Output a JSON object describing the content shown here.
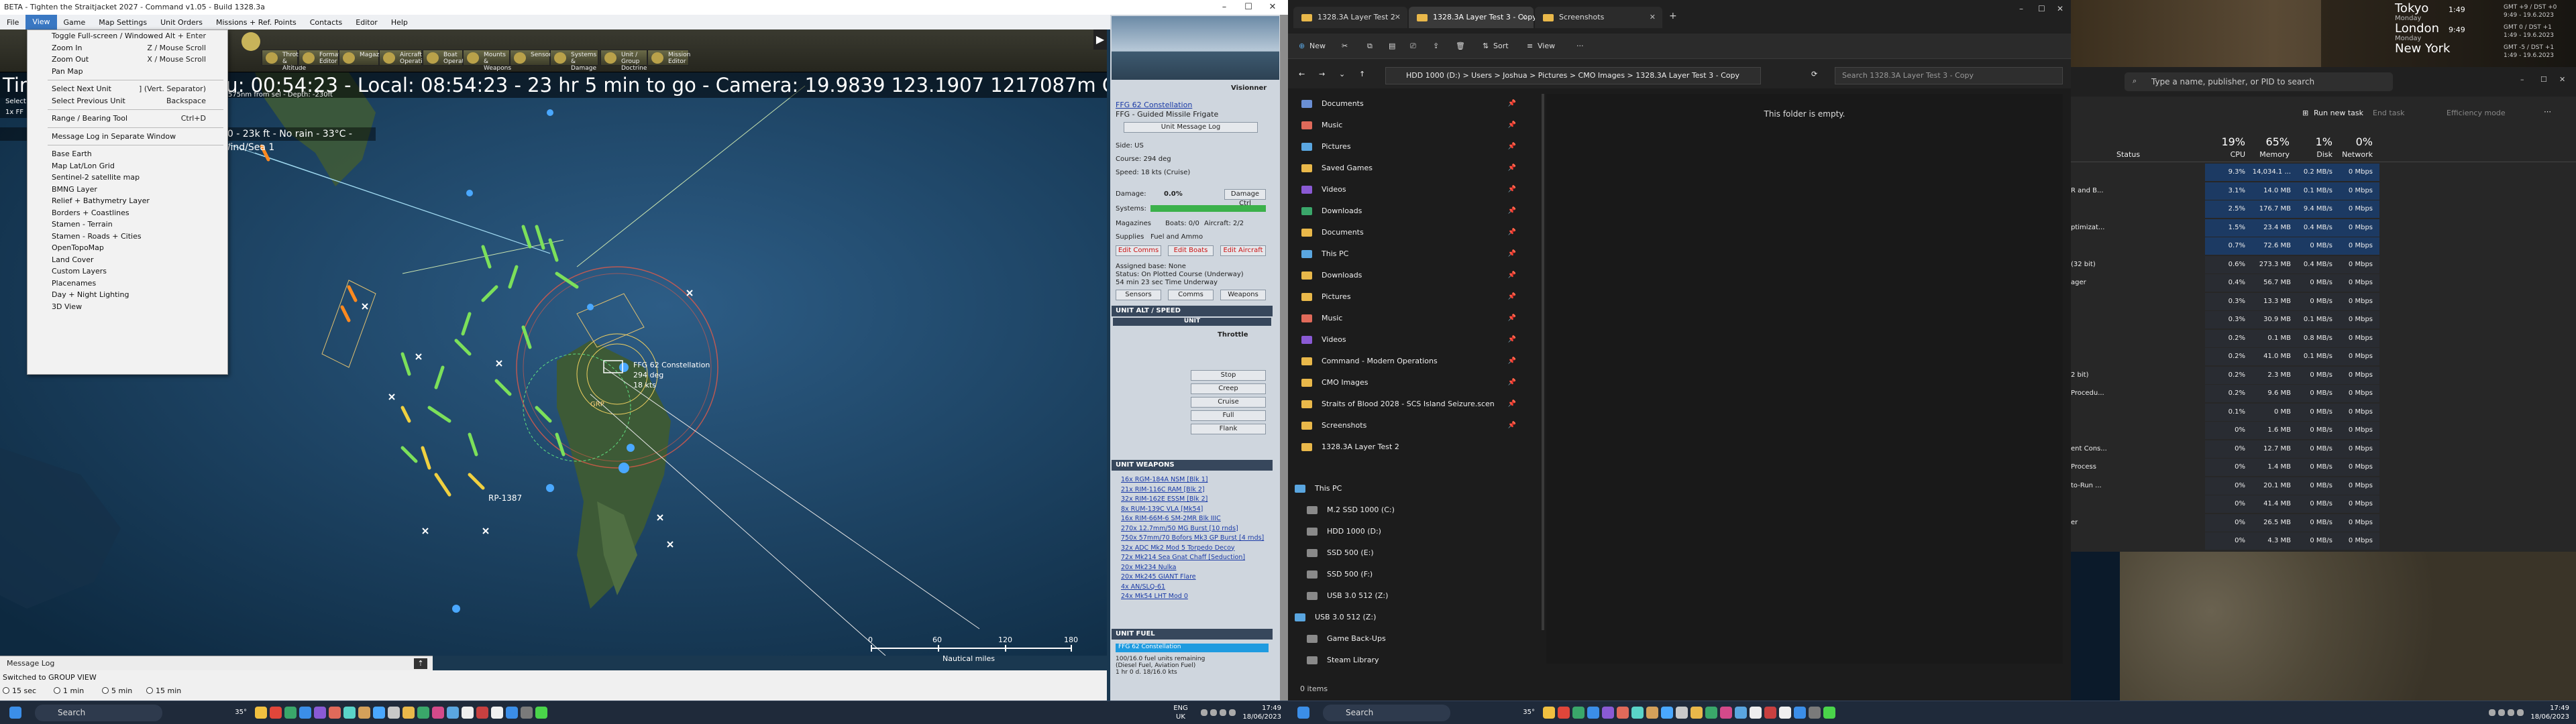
{
  "cmo": {
    "title": "BETA - Tighten the Straitjacket 2027 - Command v1.05 - Build 1328.3a",
    "menu": [
      "File",
      "View",
      "Game",
      "Map Settings",
      "Unit Orders",
      "Missions + Ref. Points",
      "Contacts",
      "Editor",
      "Help"
    ],
    "toolbar": [
      "Throttle & Altitude",
      "Formation Editor",
      "Magazines",
      "Aircraft Operations",
      "Boat Operations",
      "Mounts & Weapons",
      "Sensors",
      "Systems & Damage",
      "Unit / Group Doctrine",
      "Mission Editor"
    ],
    "status_bar": "Time: 2027/06/01 - Zulu: 00:54:23 - Local: 08:54:23 - 23 hr 5 min to go -  Camera: 19.9839 123.1907 1217087m  GPU: NVIDIA GeForce GTX 1080 Ti - AU Course: 294 deg",
    "weather": "20 - 23k ft - No rain - 33°C - Wind/Sea 1",
    "select_hint": "Select",
    "unit_hint": "1x FF",
    "depth_hint": "575nm from sel - Depth: -230ft",
    "view_menu": [
      {
        "label": "Toggle Full-screen / Windowed",
        "shortcut": "Alt + Enter"
      },
      {
        "label": "Zoom In",
        "shortcut": "Z / Mouse Scroll"
      },
      {
        "label": "Zoom Out",
        "shortcut": "X / Mouse Scroll"
      },
      {
        "label": "Pan Map",
        "shortcut": ""
      },
      {
        "label": "Select Next Unit",
        "shortcut": "] (Vert. Separator)"
      },
      {
        "label": "Select Previous Unit",
        "shortcut": "Backspace"
      },
      {
        "label": "Range / Bearing Tool",
        "shortcut": "Ctrl+D"
      },
      {
        "label": "Message Log in Separate Window",
        "shortcut": ""
      },
      {
        "label": "Base Earth",
        "shortcut": ""
      },
      {
        "label": "Map Lat/Lon Grid",
        "shortcut": ""
      },
      {
        "label": "Sentinel-2 satellite map",
        "shortcut": ""
      },
      {
        "label": "BMNG Layer",
        "shortcut": ""
      },
      {
        "label": "Relief + Bathymetry Layer",
        "shortcut": ""
      },
      {
        "label": "Borders + Coastlines",
        "shortcut": ""
      },
      {
        "label": "Stamen - Terrain",
        "shortcut": ""
      },
      {
        "label": "Stamen - Roads + Cities",
        "shortcut": ""
      },
      {
        "label": "OpenTopoMap",
        "shortcut": ""
      },
      {
        "label": "Land Cover",
        "shortcut": ""
      },
      {
        "label": "Custom Layers",
        "shortcut": ""
      },
      {
        "label": "Placenames",
        "shortcut": ""
      },
      {
        "label": "Day + Night Lighting",
        "shortcut": ""
      },
      {
        "label": "3D View",
        "shortcut": ""
      }
    ],
    "map_labels": {
      "unit": "FFG 62 Constellation",
      "course": "294 deg",
      "speed": "18 kts",
      "rp": "RP-1387",
      "grp": "GRP"
    },
    "scale": {
      "ticks": [
        "0",
        "60",
        "120",
        "180"
      ],
      "unit": "Nautical miles"
    },
    "message_log": "Message Log",
    "bottom": {
      "group_view": "Switched to GROUP VIEW",
      "speeds": [
        "15 sec",
        "1 min",
        "5 min",
        "15 min"
      ]
    },
    "side_panel": {
      "ship_name": "Visionner",
      "unit_name": "FFG 62 Constellation",
      "unit_class": "FFG - Guided Missile Frigate",
      "msg_log_btn": "Unit Message Log",
      "side": "Side: US",
      "course": "Course: 294 deg",
      "speed": "Speed: 18 kts (Cruise)",
      "damage_label": "Damage:",
      "damage_val": "0.0%",
      "damage_btn": "Damage Ctrl",
      "systems": "Systems:",
      "magazines": "Magazines",
      "boats": "Boats: 0/0",
      "aircraft": "Aircraft: 2/2",
      "supplies": "Supplies",
      "fuel": "Fuel and Ammo",
      "edit_btns": [
        "Edit Comms",
        "Edit Boats",
        "Edit Aircraft"
      ],
      "assigned": "Assigned base: None",
      "status": "Status: On Plotted Course (Underway)",
      "time": "54 min 23 sec Time Underway",
      "tabs": [
        "Sensors",
        "Comms",
        "Weapons"
      ],
      "alt_speed": "UNIT ALT / SPEED",
      "unit": "UNIT",
      "throttle": "Throttle",
      "throttle_btns": [
        "Stop",
        "Creep",
        "Cruise",
        "Full",
        "Flank"
      ],
      "weapons_head": "UNIT WEAPONS",
      "weapons": [
        "16x RGM-184A NSM [Blk 1]",
        "21x RIM-116C RAM [Blk 2]",
        "32x RIM-162E ESSM [Blk 2]",
        "8x RUM-139C VLA [Mk54]",
        "16x RIM-66M-6 SM-2MR Blk IIIC",
        "270x 12.7mm/50 MG Burst [10 rnds]",
        "750x 57mm/70 Bofors Mk3 GP Burst [4 rnds]",
        "32x ADC Mk2 Mod 5 Torpedo Decoy",
        "72x Mk214 Sea Gnat Chaff [Seduction]",
        "20x Mk234 Nulka",
        "20x Mk245 GIANT Flare",
        "4x AN/SLQ-61",
        "24x Mk54 LHT Mod 0"
      ],
      "fuel_head": "UNIT FUEL",
      "fuel_bar": "FFG 62 Constellation",
      "fuel_line1": "100/16.0 fuel units remaining",
      "fuel_line2": "(Diesel Fuel, Aviation Fuel)",
      "fuel_line3": "1 hr 0 d. 18/16.0 kts"
    }
  },
  "explorer": {
    "tabs": [
      "1328.3A Layer Test 2",
      "1328.3A Layer Test 3 - Copy",
      "Screenshots"
    ],
    "new_btn": "New",
    "sort_btn": "Sort",
    "view_btn": "View",
    "address": "HDD 1000 (D:)  >  Users  >  Joshua  >  Pictures  >  CMO Images  >  1328.3A Layer Test 3 - Copy",
    "search_placeholder": "Search 1328.3A Layer Test 3 - Copy",
    "empty_msg": "This folder is empty.",
    "nav": [
      {
        "label": "Documents",
        "color": "#6a8fd4",
        "pin": true
      },
      {
        "label": "Music",
        "color": "#e06a5a",
        "pin": true
      },
      {
        "label": "Pictures",
        "color": "#5aa6e0",
        "pin": true
      },
      {
        "label": "Saved Games",
        "color": "#e9b84a",
        "pin": true
      },
      {
        "label": "Videos",
        "color": "#8a5ad4",
        "pin": true
      },
      {
        "label": "Downloads",
        "color": "#3aa76a",
        "pin": true
      },
      {
        "label": "Documents",
        "color": "#e9b84a",
        "pin": true
      },
      {
        "label": "This PC",
        "color": "#5aa6e0",
        "pin": true
      },
      {
        "label": "Downloads",
        "color": "#e9b84a",
        "pin": true
      },
      {
        "label": "Pictures",
        "color": "#e9b84a",
        "pin": true
      },
      {
        "label": "Music",
        "color": "#e06a5a",
        "pin": true
      },
      {
        "label": "Videos",
        "color": "#8a5ad4",
        "pin": true
      },
      {
        "label": "Command - Modern Operations",
        "color": "#e9b84a",
        "pin": true
      },
      {
        "label": "CMO Images",
        "color": "#e9b84a",
        "pin": true
      },
      {
        "label": "Straits of Blood 2028 - SCS Island Seizure.scen",
        "color": "#e9b84a",
        "pin": true
      },
      {
        "label": "Screenshots",
        "color": "#e9b84a",
        "pin": true
      },
      {
        "label": "1328.3A Layer Test 2",
        "color": "#e9b84a",
        "pin": false
      }
    ],
    "tree": [
      {
        "label": "This PC",
        "indent": 0
      },
      {
        "label": "M.2 SSD 1000 (C:)",
        "indent": 1
      },
      {
        "label": "HDD 1000 (D:)",
        "indent": 1
      },
      {
        "label": "SSD 500 (E:)",
        "indent": 1
      },
      {
        "label": "SSD 500 (F:)",
        "indent": 1
      },
      {
        "label": "USB 3.0 512 (Z:)",
        "indent": 1
      },
      {
        "label": "USB 3.0 512 (Z:)",
        "indent": 0
      },
      {
        "label": "Game Back-Ups",
        "indent": 1
      },
      {
        "label": "Steam Library",
        "indent": 1
      }
    ],
    "status": "0 items"
  },
  "taskmgr": {
    "search": "Type a name, publisher, or PID to search",
    "run_task": "Run new task",
    "end_task": "End task",
    "efficiency": "Efficiency mode",
    "headers": {
      "status": "Status",
      "cpu_pct": "19%",
      "cpu": "CPU",
      "mem_pct": "65%",
      "mem": "Memory",
      "disk_pct": "1%",
      "disk": "Disk",
      "net_pct": "0%",
      "net": "Network"
    },
    "rows": [
      {
        "name": "",
        "cpu": "9.3%",
        "mem": "14,034.1 ...",
        "disk": "0.2 MB/s",
        "net": "0 Mbps"
      },
      {
        "name": "R and B...",
        "cpu": "3.1%",
        "mem": "14.0 MB",
        "disk": "0.1 MB/s",
        "net": "0 Mbps"
      },
      {
        "name": "",
        "cpu": "2.5%",
        "mem": "176.7 MB",
        "disk": "9.4 MB/s",
        "net": "0 Mbps"
      },
      {
        "name": "ptimizat...",
        "cpu": "1.5%",
        "mem": "23.4 MB",
        "disk": "0.4 MB/s",
        "net": "0 Mbps"
      },
      {
        "name": "",
        "cpu": "0.7%",
        "mem": "72.6 MB",
        "disk": "0 MB/s",
        "net": "0 Mbps"
      },
      {
        "name": "(32 bit)",
        "cpu": "0.6%",
        "mem": "273.3 MB",
        "disk": "0.4 MB/s",
        "net": "0 Mbps"
      },
      {
        "name": "ager",
        "cpu": "0.4%",
        "mem": "56.7 MB",
        "disk": "0 MB/s",
        "net": "0 Mbps"
      },
      {
        "name": "",
        "cpu": "0.3%",
        "mem": "13.3 MB",
        "disk": "0 MB/s",
        "net": "0 Mbps"
      },
      {
        "name": "",
        "cpu": "0.3%",
        "mem": "30.9 MB",
        "disk": "0.1 MB/s",
        "net": "0 Mbps"
      },
      {
        "name": "",
        "cpu": "0.2%",
        "mem": "0.1 MB",
        "disk": "0.8 MB/s",
        "net": "0 Mbps"
      },
      {
        "name": "",
        "cpu": "0.2%",
        "mem": "41.0 MB",
        "disk": "0.1 MB/s",
        "net": "0 Mbps"
      },
      {
        "name": "2 bit)",
        "cpu": "0.2%",
        "mem": "2.3 MB",
        "disk": "0 MB/s",
        "net": "0 Mbps"
      },
      {
        "name": "Procedu...",
        "cpu": "0.2%",
        "mem": "9.6 MB",
        "disk": "0 MB/s",
        "net": "0 Mbps"
      },
      {
        "name": "",
        "cpu": "0.1%",
        "mem": "0 MB",
        "disk": "0 MB/s",
        "net": "0 Mbps"
      },
      {
        "name": "",
        "cpu": "0%",
        "mem": "1.6 MB",
        "disk": "0 MB/s",
        "net": "0 Mbps"
      },
      {
        "name": "ent Cons...",
        "cpu": "0%",
        "mem": "12.7 MB",
        "disk": "0 MB/s",
        "net": "0 Mbps"
      },
      {
        "name": "Process",
        "cpu": "0%",
        "mem": "1.4 MB",
        "disk": "0 MB/s",
        "net": "0 Mbps"
      },
      {
        "name": "to-Run ...",
        "cpu": "0%",
        "mem": "20.1 MB",
        "disk": "0 MB/s",
        "net": "0 Mbps"
      },
      {
        "name": "",
        "cpu": "0%",
        "mem": "41.4 MB",
        "disk": "0 MB/s",
        "net": "0 Mbps"
      },
      {
        "name": "er",
        "cpu": "0%",
        "mem": "26.5 MB",
        "disk": "0 MB/s",
        "net": "0 Mbps"
      },
      {
        "name": "",
        "cpu": "0%",
        "mem": "4.3 MB",
        "disk": "0 MB/s",
        "net": "0 Mbps"
      }
    ]
  },
  "clocks": [
    {
      "city": "Tokyo",
      "day": "Monday",
      "time": "1:49",
      "right": "GMT +9 / DST +0",
      "right2": "9:49 - 19.6.2023"
    },
    {
      "city": "London",
      "day": "Monday",
      "time": "9:49",
      "right": "GMT 0 / DST +1",
      "right2": "1:49 - 19.6.2023"
    },
    {
      "city": "New York",
      "day": "",
      "time": "",
      "right": "GMT -5 / DST +1",
      "right2": "1:49 - 19.6.2023"
    }
  ],
  "taskbar": {
    "search": "Search",
    "lang": "ENG",
    "region": "UK",
    "time": "17:49",
    "date": "18/06/2023",
    "temp": "35°"
  }
}
